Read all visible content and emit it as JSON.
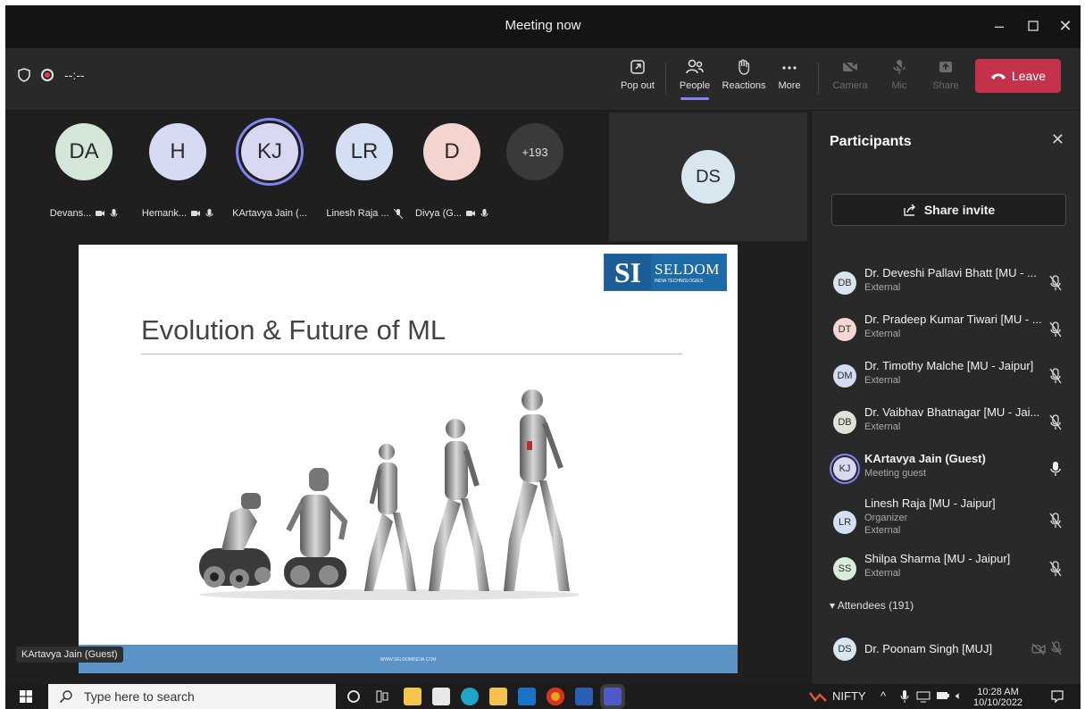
{
  "window": {
    "title": "Meeting now"
  },
  "toolbar": {
    "timer": "--:--",
    "pop_out": "Pop out",
    "people": "People",
    "reactions": "Reactions",
    "more": "More",
    "camera": "Camera",
    "mic": "Mic",
    "share": "Share",
    "leave": "Leave"
  },
  "stage": {
    "tiles": [
      {
        "initials": "DA",
        "name": "Devans...",
        "color": "#d4e6d8"
      },
      {
        "initials": "H",
        "name": "Hemank...",
        "color": "#d6dbf3"
      },
      {
        "initials": "KJ",
        "name": "KArtavya Jain (...",
        "color": "#d8d8f2"
      },
      {
        "initials": "LR",
        "name": "Linesh Raja ...",
        "color": "#d3dff2"
      },
      {
        "initials": "D",
        "name": "Divya (G...",
        "color": "#f4d4cf"
      }
    ],
    "overflow": "+193",
    "spotlight": {
      "initials": "DS"
    },
    "speaker_label": "KArtavya Jain (Guest)"
  },
  "slide": {
    "logo_mark": "SI",
    "logo_name": "SELDOM",
    "logo_sub": "INDIA TECHNOLOGIES",
    "title": "Evolution & Future of ML",
    "footer": "WWW.SELDOMINDIA.COM"
  },
  "panel": {
    "title": "Participants",
    "share_invite": "Share invite",
    "participants": [
      {
        "initials": "DB",
        "name": "Dr. Deveshi Pallavi Bhatt [MU - ...",
        "sub1": "External",
        "sub2": "",
        "color": "#d9e4ee",
        "mic": "muted"
      },
      {
        "initials": "DT",
        "name": "Dr. Pradeep Kumar Tiwari [MU - ...",
        "sub1": "External",
        "sub2": "",
        "color": "#f3d7d2",
        "mic": "muted"
      },
      {
        "initials": "DM",
        "name": "Dr. Timothy Malche [MU - Jaipur]",
        "sub1": "External",
        "sub2": "",
        "color": "#d4dcf1",
        "mic": "muted"
      },
      {
        "initials": "DB",
        "name": "Dr. Vaibhav Bhatnagar [MU - Jai...",
        "sub1": "External",
        "sub2": "",
        "color": "#dfe3d6",
        "mic": "muted"
      },
      {
        "initials": "KJ",
        "name": "KArtavya Jain (Guest)",
        "sub1": "Meeting guest",
        "sub2": "",
        "color": "#d8d8f2",
        "mic": "on"
      },
      {
        "initials": "LR",
        "name": "Linesh Raja [MU - Jaipur]",
        "sub1": "Organizer",
        "sub2": "External",
        "color": "#d3dff2",
        "mic": "muted"
      },
      {
        "initials": "SS",
        "name": "Shilpa Sharma [MU - Jaipur]",
        "sub1": "External",
        "sub2": "",
        "color": "#d9ecdc",
        "mic": "muted"
      }
    ],
    "attendees_header": "Attendees (191)",
    "attendees": [
      {
        "initials": "DS",
        "name": "Dr. Poonam Singh [MUJ]",
        "color": "#d7e6ef"
      }
    ]
  },
  "taskbar": {
    "search_placeholder": "Type here to search",
    "nifty": "NIFTY",
    "time": "10:28 AM",
    "date": "10/10/2022"
  },
  "colors": {
    "accent": "#7f85f5",
    "leave": "#c4314b",
    "slide_footer": "#5b93c6"
  }
}
